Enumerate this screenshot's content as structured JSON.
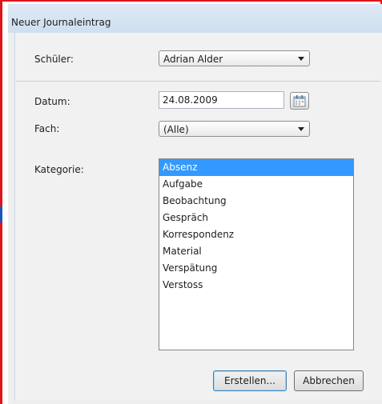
{
  "window": {
    "title": "Neuer Journaleintrag"
  },
  "form": {
    "student": {
      "label": "Schüler:",
      "value": "Adrian Alder"
    },
    "date": {
      "label": "Datum:",
      "value": "24.08.2009"
    },
    "subject": {
      "label": "Fach:",
      "value": "(Alle)"
    },
    "category": {
      "label": "Kategorie:",
      "items": [
        "Absenz",
        "Aufgabe",
        "Beobachtung",
        "Gespräch",
        "Korrespondenz",
        "Material",
        "Verspätung",
        "Verstoss"
      ],
      "selected": "Absenz"
    }
  },
  "buttons": {
    "create": "Erstellen...",
    "cancel": "Abbrechen"
  },
  "icons": {
    "calendar": "calendar-icon",
    "dropdown": "chevron-down-icon"
  },
  "colors": {
    "selection": "#3399ff",
    "frame_accent": "#e0141b"
  }
}
